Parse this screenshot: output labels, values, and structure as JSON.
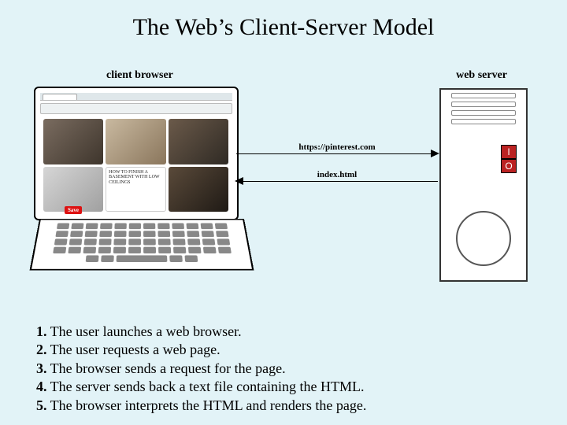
{
  "title": "The Web’s Client-Server Model",
  "labels": {
    "client": "client browser",
    "server": "web server"
  },
  "arrows": {
    "request": "https://pinterest.com",
    "response": "index.html"
  },
  "screenshot_hint": "HOW TO FINISH A BASEMENT WITH LOW CEILINGS",
  "io": {
    "i": "I",
    "o": "O"
  },
  "save": "Save",
  "steps": [
    {
      "n": "1.",
      "t": " The user launches a web browser."
    },
    {
      "n": "2.",
      "t": " The user requests a web page."
    },
    {
      "n": "3.",
      "t": " The browser sends a request for the page."
    },
    {
      "n": "4.",
      "t": " The server sends back a text file containing the HTML."
    },
    {
      "n": "5.",
      "t": " The browser interprets the HTML and renders the page."
    }
  ]
}
